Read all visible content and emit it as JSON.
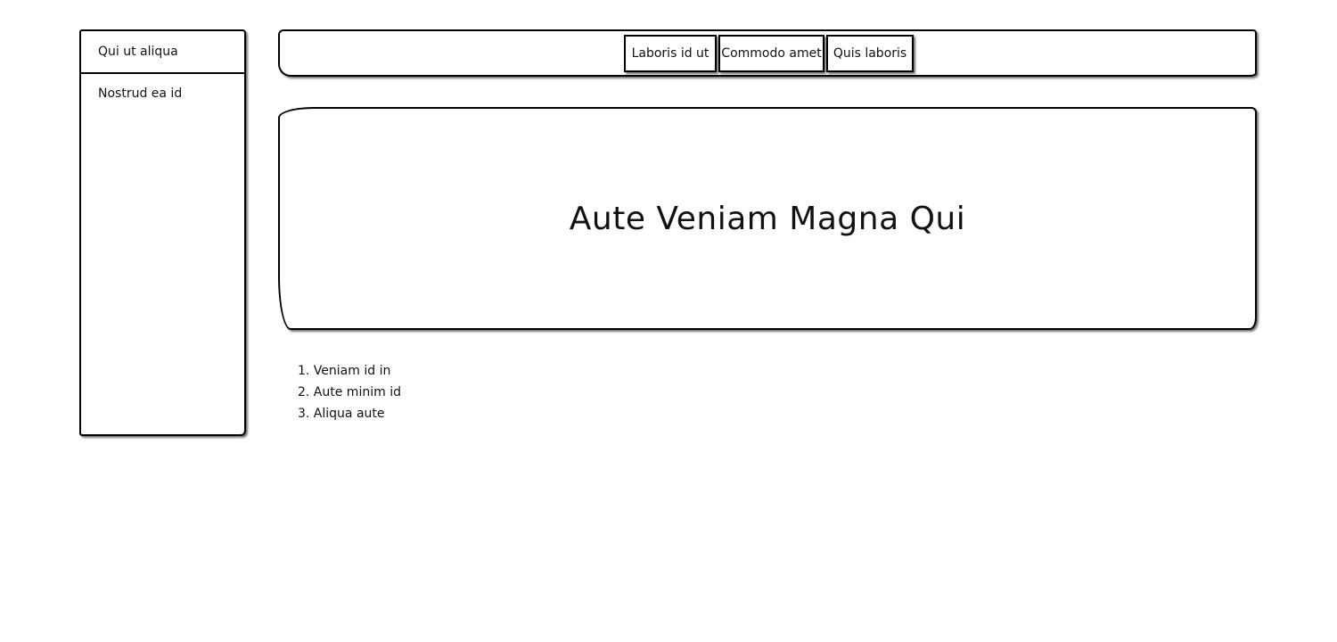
{
  "sidebar": {
    "header": "Qui ut aliqua",
    "items": [
      {
        "label": "Nostrud ea id"
      }
    ]
  },
  "nav": {
    "buttons": [
      {
        "label": "Laboris id ut"
      },
      {
        "label": "Commodo amet"
      },
      {
        "label": "Quis laboris"
      }
    ]
  },
  "hero": {
    "title": "Aute Veniam Magna Qui"
  },
  "list": {
    "items": [
      {
        "label": "1. Veniam id in"
      },
      {
        "label": "2. Aute minim id"
      },
      {
        "label": "3. Aliqua aute"
      }
    ]
  }
}
